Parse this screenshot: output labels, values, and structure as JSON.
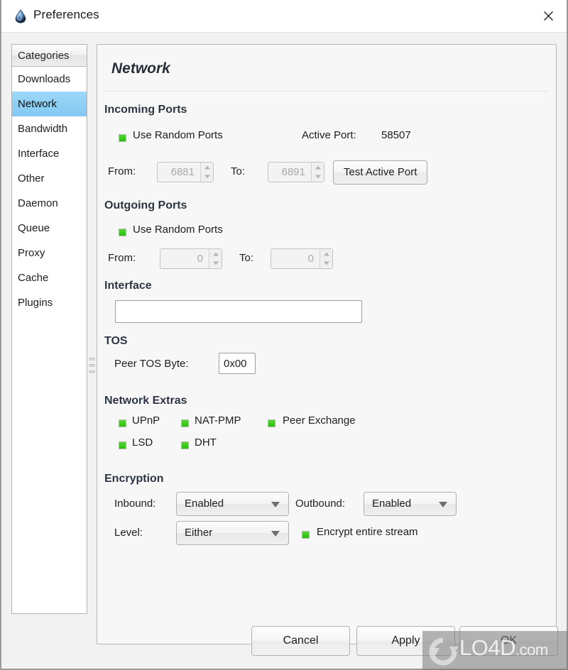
{
  "window": {
    "title": "Preferences",
    "icon": "deluge-droplet-icon",
    "close_label": "×"
  },
  "sidebar": {
    "header": "Categories",
    "selected": "Network",
    "items": [
      {
        "label": "Downloads"
      },
      {
        "label": "Network"
      },
      {
        "label": "Bandwidth"
      },
      {
        "label": "Interface"
      },
      {
        "label": "Other"
      },
      {
        "label": "Daemon"
      },
      {
        "label": "Queue"
      },
      {
        "label": "Proxy"
      },
      {
        "label": "Cache"
      },
      {
        "label": "Plugins"
      }
    ]
  },
  "page": {
    "title": "Network",
    "incoming": {
      "heading": "Incoming Ports",
      "random_label": "Use Random Ports",
      "random_checked": true,
      "active_port_label": "Active Port:",
      "active_port_value": "58507",
      "from_label": "From:",
      "from_value": "6881",
      "to_label": "To:",
      "to_value": "6891",
      "test_button": "Test Active Port"
    },
    "outgoing": {
      "heading": "Outgoing Ports",
      "random_label": "Use Random Ports",
      "random_checked": true,
      "from_label": "From:",
      "from_value": "0",
      "to_label": "To:",
      "to_value": "0"
    },
    "interface": {
      "heading": "Interface",
      "value": "",
      "placeholder": ""
    },
    "tos": {
      "heading": "TOS",
      "label": "Peer TOS Byte:",
      "value": "0x00"
    },
    "extras": {
      "heading": "Network Extras",
      "items": [
        {
          "label": "UPnP",
          "checked": true
        },
        {
          "label": "NAT-PMP",
          "checked": true
        },
        {
          "label": "Peer Exchange",
          "checked": true
        },
        {
          "label": "LSD",
          "checked": true
        },
        {
          "label": "DHT",
          "checked": true
        }
      ]
    },
    "encryption": {
      "heading": "Encryption",
      "inbound_label": "Inbound:",
      "inbound_value": "Enabled",
      "outbound_label": "Outbound:",
      "outbound_value": "Enabled",
      "level_label": "Level:",
      "level_value": "Either",
      "entire_stream_label": "Encrypt entire stream",
      "entire_stream_checked": true
    }
  },
  "footer": {
    "cancel": "Cancel",
    "apply": "Apply",
    "ok": "OK"
  },
  "watermark": {
    "text": "LO4D",
    "suffix": ".com"
  },
  "colors": {
    "selection": "#8ecff5",
    "checkbox_green": "#2bbf0d",
    "heading": "#2b3440",
    "window_bg": "#f2f2f2"
  }
}
